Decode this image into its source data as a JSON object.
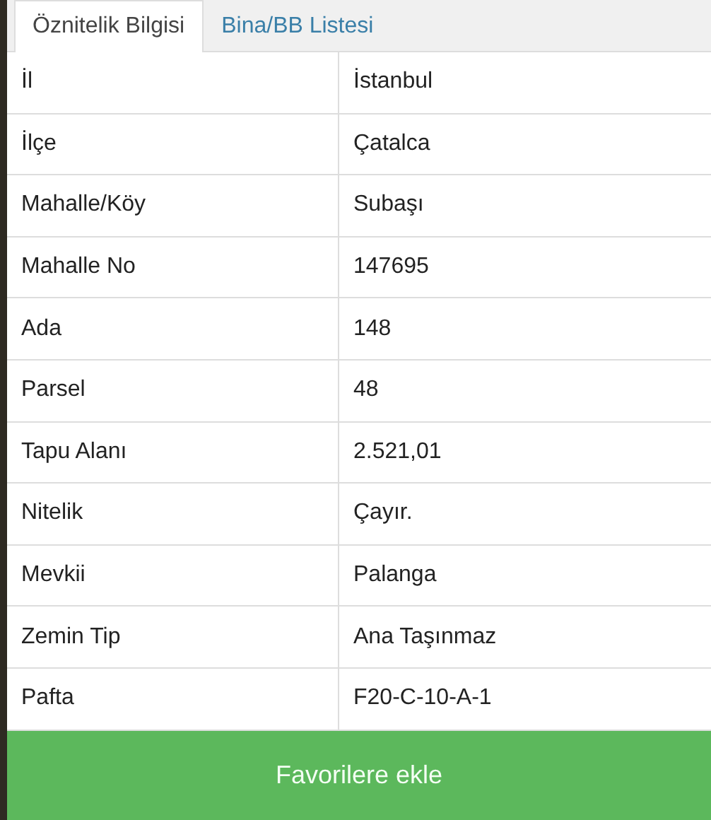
{
  "tabs": [
    {
      "label": "Öznitelik Bilgisi",
      "selected": true
    },
    {
      "label": "Bina/BB Listesi",
      "selected": false
    }
  ],
  "rows": [
    {
      "label": "İl",
      "value": "İstanbul"
    },
    {
      "label": "İlçe",
      "value": "Çatalca"
    },
    {
      "label": "Mahalle/Köy",
      "value": "Subaşı"
    },
    {
      "label": "Mahalle No",
      "value": "147695"
    },
    {
      "label": "Ada",
      "value": "148"
    },
    {
      "label": "Parsel",
      "value": "48"
    },
    {
      "label": "Tapu Alanı",
      "value": "2.521,01"
    },
    {
      "label": "Nitelik",
      "value": "Çayır."
    },
    {
      "label": "Mevkii",
      "value": "Palanga"
    },
    {
      "label": "Zemin Tip",
      "value": "Ana Taşınmaz"
    },
    {
      "label": "Pafta",
      "value": "F20-C-10-A-1"
    }
  ],
  "button": "Favorilere ekle"
}
